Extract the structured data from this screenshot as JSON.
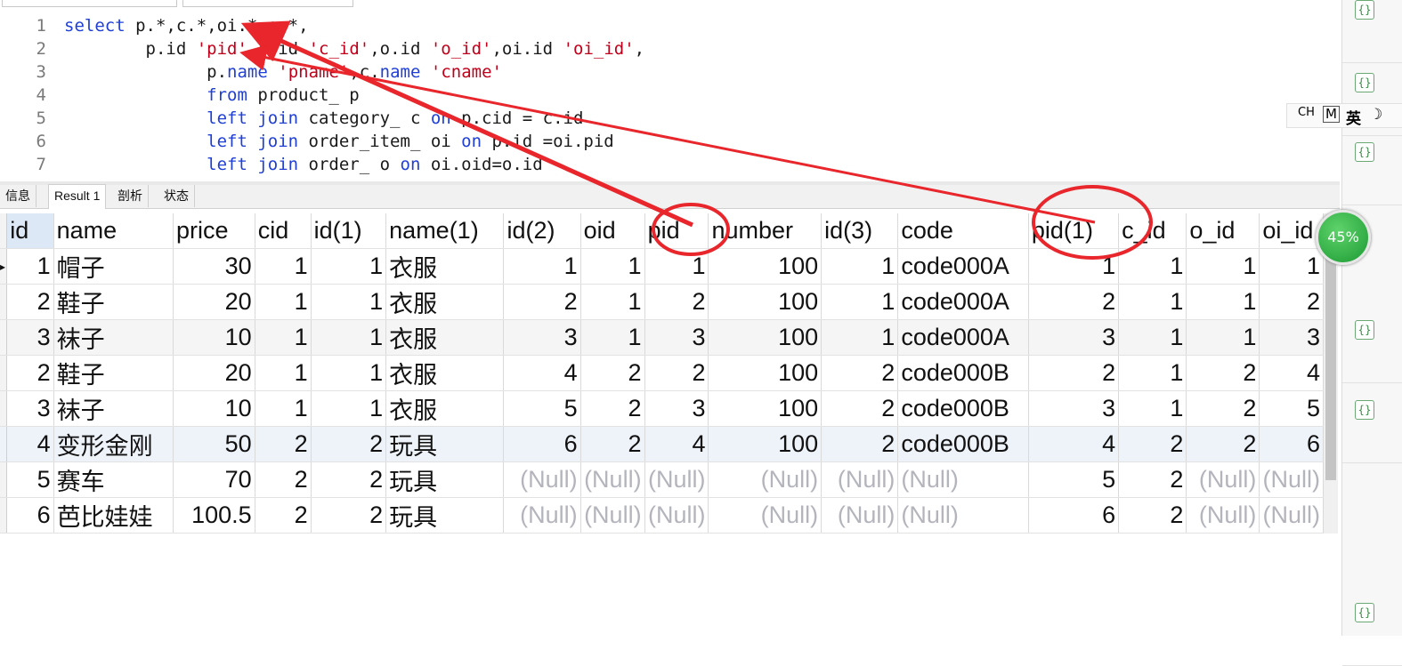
{
  "editor": {
    "lines": [
      {
        "num": "1",
        "indent": "",
        "tokens": [
          [
            "kw",
            "select"
          ],
          [
            "tx",
            " p.*,c.*,oi.*,o.*,"
          ]
        ]
      },
      {
        "num": "2",
        "indent": "        ",
        "tokens": [
          [
            "tx",
            "p.id "
          ],
          [
            "str",
            "'pid'"
          ],
          [
            "tx",
            ",c.id "
          ],
          [
            "str",
            "'c_id'"
          ],
          [
            "tx",
            ",o.id "
          ],
          [
            "str",
            "'o_id'"
          ],
          [
            "tx",
            ",oi.id "
          ],
          [
            "str",
            "'oi_id'"
          ],
          [
            "tx",
            ","
          ]
        ]
      },
      {
        "num": "3",
        "indent": "              ",
        "tokens": [
          [
            "tx",
            "p."
          ],
          [
            "kw",
            "name"
          ],
          [
            "tx",
            " "
          ],
          [
            "str",
            "'pname'"
          ],
          [
            "tx",
            ",c."
          ],
          [
            "kw",
            "name"
          ],
          [
            "tx",
            " "
          ],
          [
            "str",
            "'cname'"
          ]
        ]
      },
      {
        "num": "4",
        "indent": "              ",
        "tokens": [
          [
            "kw",
            "from"
          ],
          [
            "tx",
            " product_ p"
          ]
        ]
      },
      {
        "num": "5",
        "indent": "              ",
        "tokens": [
          [
            "kw",
            "left join"
          ],
          [
            "tx",
            " category_ c "
          ],
          [
            "kw",
            "on"
          ],
          [
            "tx",
            " p.cid = c.id"
          ]
        ]
      },
      {
        "num": "6",
        "indent": "              ",
        "tokens": [
          [
            "kw",
            "left join"
          ],
          [
            "tx",
            " order_item_ oi "
          ],
          [
            "kw",
            "on"
          ],
          [
            "tx",
            " p.id =oi.pid"
          ]
        ]
      },
      {
        "num": "7",
        "indent": "              ",
        "tokens": [
          [
            "kw",
            "left join"
          ],
          [
            "tx",
            " order_ o "
          ],
          [
            "kw",
            "on"
          ],
          [
            "tx",
            " oi.oid=o.id"
          ]
        ]
      }
    ]
  },
  "tabs": {
    "info": "信息",
    "result": "Result 1",
    "profile": "剖析",
    "status": "状态"
  },
  "grid": {
    "columns": [
      "id",
      "name",
      "price",
      "cid",
      "id(1)",
      "name(1)",
      "id(2)",
      "oid",
      "pid",
      "number",
      "id(3)",
      "code",
      "pid(1)",
      "c_id",
      "o_id",
      "oi_id"
    ],
    "rows": [
      [
        "1",
        "帽子",
        "30",
        "1",
        "1",
        "衣服",
        "1",
        "1",
        "1",
        "100",
        "1",
        "code000A",
        "1",
        "1",
        "1",
        "1"
      ],
      [
        "2",
        "鞋子",
        "20",
        "1",
        "1",
        "衣服",
        "2",
        "1",
        "2",
        "100",
        "1",
        "code000A",
        "2",
        "1",
        "1",
        "2"
      ],
      [
        "3",
        "袜子",
        "10",
        "1",
        "1",
        "衣服",
        "3",
        "1",
        "3",
        "100",
        "1",
        "code000A",
        "3",
        "1",
        "1",
        "3"
      ],
      [
        "2",
        "鞋子",
        "20",
        "1",
        "1",
        "衣服",
        "4",
        "2",
        "2",
        "100",
        "2",
        "code000B",
        "2",
        "1",
        "2",
        "4"
      ],
      [
        "3",
        "袜子",
        "10",
        "1",
        "1",
        "衣服",
        "5",
        "2",
        "3",
        "100",
        "2",
        "code000B",
        "3",
        "1",
        "2",
        "5"
      ],
      [
        "4",
        "变形金刚",
        "50",
        "2",
        "2",
        "玩具",
        "6",
        "2",
        "4",
        "100",
        "2",
        "code000B",
        "4",
        "2",
        "2",
        "6"
      ],
      [
        "5",
        "赛车",
        "70",
        "2",
        "2",
        "玩具",
        "(Null)",
        "(Null)",
        "(Null)",
        "(Null)",
        "(Null)",
        "(Null)",
        "5",
        "2",
        "(Null)",
        "(Null)"
      ],
      [
        "6",
        "芭比娃娃",
        "100.5",
        "2",
        "2",
        "玩具",
        "(Null)",
        "(Null)",
        "(Null)",
        "(Null)",
        "(Null)",
        "(Null)",
        "6",
        "2",
        "(Null)",
        "(Null)"
      ]
    ],
    "text_columns": [
      1,
      5,
      11
    ]
  },
  "ime": {
    "ch": "CH",
    "m": "M",
    "lang": "英"
  },
  "badge": {
    "percent": "45%"
  },
  "colors": {
    "annotation": "#e8262b",
    "keyword": "#1f3fd6",
    "string": "#c0001a"
  }
}
